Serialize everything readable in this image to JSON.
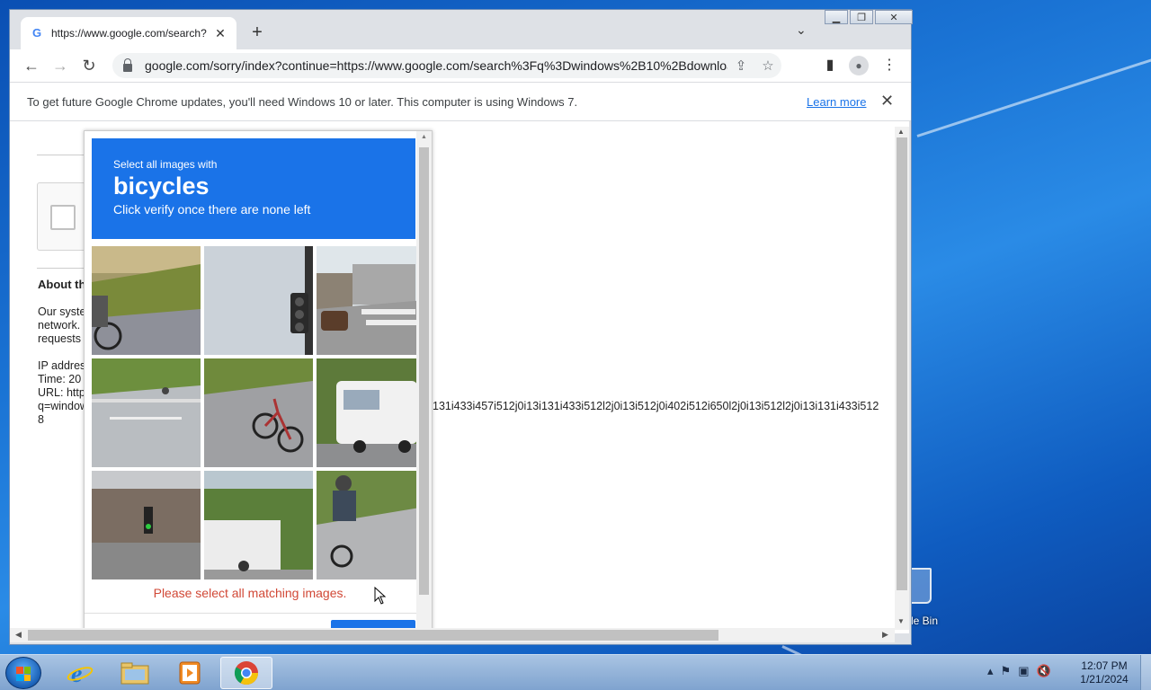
{
  "browser": {
    "tab_title": "https://www.google.com/search?",
    "favicon": "G",
    "new_tab_symbol": "+",
    "url": "google.com/sorry/index?continue=https://www.google.com/search%3Fq%3Dwindows%2B10%2Bdownload...",
    "infobar": {
      "message": "To get future Google Chrome updates, you'll need Windows 10 or later. This computer is using Windows 7.",
      "learn_more": "Learn more"
    }
  },
  "page": {
    "about_heading": "About th",
    "para_lines": [
      "Our syste",
      "network.",
      "requests"
    ],
    "info_lines": [
      "IP addres",
      "Time: 20",
      "URL: http",
      "q=window",
      "8"
    ],
    "long_line": "131i433i457i512j0i13i131i433i512l2j0i13i512j0i402i512i650l2j0i13i512l2j0i13i131i433i512"
  },
  "captcha": {
    "instruction": "Select all images with",
    "target": "bicycles",
    "subtext": "Click verify once there are none left",
    "error": "Please select all matching images.",
    "tiles": [
      "cyclist-on-sidewalk",
      "traffic-light-closeup",
      "street-intersection",
      "crosswalk-cyclist",
      "parked-bicycle",
      "white-bus",
      "street-traffic-light",
      "white-building-motorbike",
      "rider-on-bicycle"
    ]
  },
  "taskbar": {
    "time": "12:07 PM",
    "date": "1/21/2024",
    "apps": [
      "internet-explorer",
      "file-explorer",
      "media-player",
      "chrome"
    ]
  },
  "desktop": {
    "recycle_bin_label": "le Bin"
  },
  "colors": {
    "captcha_blue": "#1a73e8",
    "error_red": "#d14836",
    "link_blue": "#1a73e8"
  }
}
